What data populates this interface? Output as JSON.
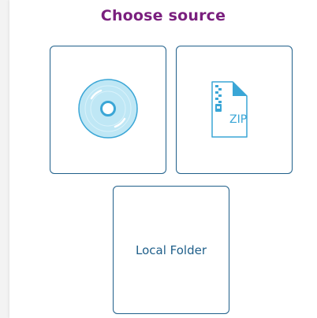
{
  "header": {
    "title": "Choose source"
  },
  "sources": {
    "disc": {
      "icon": "disc-icon"
    },
    "zip": {
      "icon": "zip-file-icon",
      "label": "ZIP"
    },
    "folder": {
      "label": "Local Folder"
    }
  },
  "colors": {
    "title": "#7a1f7e",
    "tile_border": "#1f5f8a",
    "icon_fill": "#bfe7f5",
    "icon_stroke": "#3aa6d6"
  }
}
